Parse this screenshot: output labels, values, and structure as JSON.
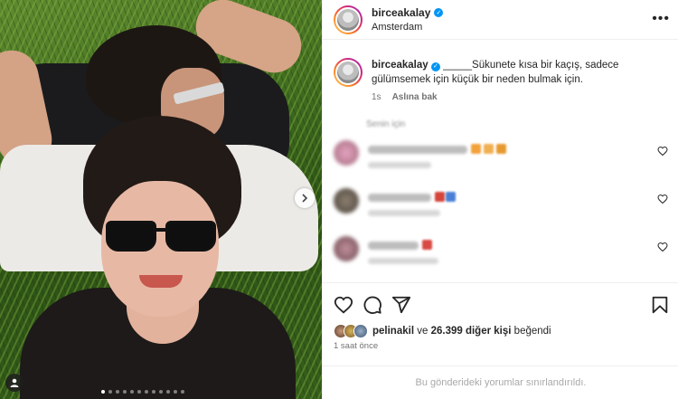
{
  "post": {
    "username": "birceakalay",
    "location": "Amsterdam",
    "caption_user": "birceakalay",
    "caption_text": "_____Sükunete kısa bir kaçış, sadece gülümsemek için küçük bir neden bulmak için.",
    "age": "1s",
    "see_translation": "Aslına bak",
    "section_label": "Senin için",
    "liked_by_user": "pelinakil",
    "likes_connector": "ve",
    "likes_count_text": "26.399 diğer kişi",
    "likes_suffix": "beğendi",
    "time_ago": "1 saat önce",
    "comments_limited": "Bu gönderideki yorumlar sınırlandırıldı.",
    "carousel": {
      "slide_count": 12,
      "active_index": 0
    }
  },
  "colors": {
    "verified": "#0095f6",
    "text": "#262626",
    "muted": "#737373",
    "story_ring": [
      "#feda75",
      "#fa7e1e",
      "#d62976",
      "#962fbf"
    ]
  },
  "icons": {
    "more": "more-options-icon",
    "verified": "verified-badge-icon",
    "like": "heart-icon",
    "comment": "comment-icon",
    "share": "send-icon",
    "save": "bookmark-icon",
    "next": "chevron-right-icon",
    "tag": "user-tag-icon"
  }
}
